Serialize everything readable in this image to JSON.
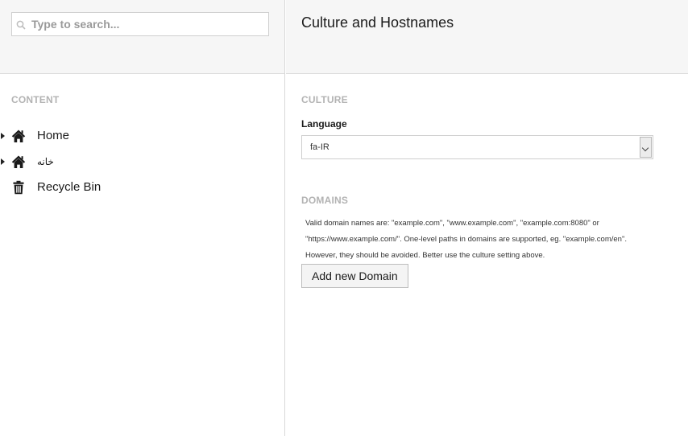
{
  "search": {
    "placeholder": "Type to search..."
  },
  "sidebar": {
    "section_label": "CONTENT",
    "items": [
      {
        "label": "Home",
        "icon": "home-icon",
        "expandable": true
      },
      {
        "label": "خانه",
        "icon": "home-icon",
        "expandable": true
      },
      {
        "label": "Recycle Bin",
        "icon": "trash-icon",
        "expandable": false
      }
    ]
  },
  "main": {
    "title": "Culture and Hostnames",
    "culture": {
      "section_label": "CULTURE",
      "language_label": "Language",
      "language_value": "fa-IR"
    },
    "domains": {
      "section_label": "DOMAINS",
      "help_text": "Valid domain names are: \"example.com\", \"www.example.com\", \"example.com:8080\" or \"https://www.example.com/\". One-level paths in domains are supported, eg. \"example.com/en\". However, they should be avoided. Better use the culture setting above.",
      "add_button": "Add new Domain"
    }
  }
}
